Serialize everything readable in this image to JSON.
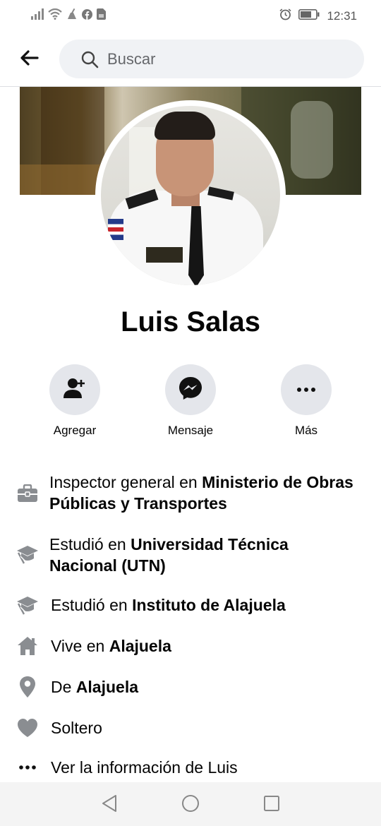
{
  "status_bar": {
    "time": "12:31",
    "icons": [
      "signal-icon",
      "wifi-icon",
      "cleaner-icon",
      "facebook-icon",
      "sim-card-icon",
      "alarm-icon",
      "battery-icon"
    ]
  },
  "header": {
    "search_placeholder": "Buscar"
  },
  "profile": {
    "name": "Luis Salas"
  },
  "actions": [
    {
      "label": "Agregar",
      "icon": "add-friend-icon"
    },
    {
      "label": "Mensaje",
      "icon": "messenger-icon"
    },
    {
      "label": "Más",
      "icon": "more-icon"
    }
  ],
  "info": [
    {
      "icon": "briefcase-icon",
      "prefix": "Inspector general en ",
      "bold": "Ministerio de Obras Públicas y Transportes"
    },
    {
      "icon": "graduation-cap-icon",
      "prefix": "Estudió en ",
      "bold": "Universidad Técnica Nacional (UTN)"
    },
    {
      "icon": "graduation-cap-icon",
      "prefix": "Estudió en ",
      "bold": "Instituto de Alajuela"
    },
    {
      "icon": "home-icon",
      "prefix": "Vive en ",
      "bold": "Alajuela"
    },
    {
      "icon": "location-pin-icon",
      "prefix": "De ",
      "bold": "Alajuela"
    },
    {
      "icon": "heart-icon",
      "prefix": "Soltero",
      "bold": ""
    },
    {
      "icon": "more-icon",
      "prefix": "Ver la información de Luis",
      "bold": ""
    }
  ],
  "colors": {
    "icon_gray": "#606770",
    "button_bg": "#e4e6eb",
    "search_bg": "#f0f2f5"
  }
}
